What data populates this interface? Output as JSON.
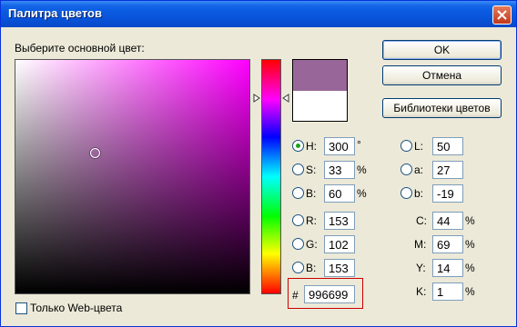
{
  "window": {
    "title": "Палитра цветов"
  },
  "picker": {
    "label": "Выберите основной цвет:"
  },
  "buttons": {
    "ok": "OK",
    "cancel": "Отмена",
    "libraries": "Библиотеки цветов"
  },
  "hsb": {
    "h": {
      "label": "H:",
      "value": "300",
      "unit": "°",
      "checked": true
    },
    "s": {
      "label": "S:",
      "value": "33",
      "unit": "%"
    },
    "b": {
      "label": "B:",
      "value": "60",
      "unit": "%"
    }
  },
  "rgb": {
    "r": {
      "label": "R:",
      "value": "153"
    },
    "g": {
      "label": "G:",
      "value": "102"
    },
    "b": {
      "label": "B:",
      "value": "153"
    }
  },
  "lab": {
    "l": {
      "label": "L:",
      "value": "50"
    },
    "a": {
      "label": "a:",
      "value": "27"
    },
    "b": {
      "label": "b:",
      "value": "-19"
    }
  },
  "cmyk": {
    "c": {
      "label": "C:",
      "value": "44",
      "unit": "%"
    },
    "m": {
      "label": "M:",
      "value": "69",
      "unit": "%"
    },
    "y": {
      "label": "Y:",
      "value": "14",
      "unit": "%"
    },
    "k": {
      "label": "K:",
      "value": "1",
      "unit": "%"
    }
  },
  "hex": {
    "label": "#",
    "value": "996699"
  },
  "web_only": {
    "label": "Только Web-цвета",
    "checked": false
  },
  "colors": {
    "new_color": "#996699",
    "old_color": "#ffffff",
    "hue_color": "#ff00ff",
    "highlight": "#cc0000"
  }
}
